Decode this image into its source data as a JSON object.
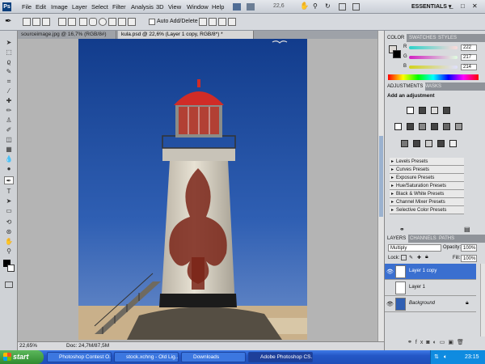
{
  "menubar": {
    "logo": "Ps",
    "items": [
      "File",
      "Edit",
      "Image",
      "Layer",
      "Select",
      "Filter",
      "Analysis",
      "3D",
      "View",
      "Window",
      "Help"
    ],
    "zoom": "22,6",
    "workspace": "ESSENTIALS ▾"
  },
  "options": {
    "auto_add_delete": "Auto Add/Delete"
  },
  "tabs": [
    {
      "label": "sourceimage.jpg @ 16,7% (RGB/8#)"
    },
    {
      "label": "kula.psd @ 22,6% (Layer 1 copy, RGB/8*) *"
    }
  ],
  "status": {
    "zoom": "22,65%",
    "doc": "Doc: 24,7M/87,5M"
  },
  "color_panel": {
    "tabs": [
      "COLOR",
      "SWATCHES",
      "STYLES"
    ],
    "channels": [
      {
        "label": "R",
        "value": "222",
        "color": "#dedad6"
      },
      {
        "label": "G",
        "value": "217",
        "color": "#d9d9d9"
      },
      {
        "label": "B",
        "value": "214",
        "color": "#d6d6d6"
      }
    ]
  },
  "adjustments_panel": {
    "tabs": [
      "ADJUSTMENTS",
      "MASKS"
    ],
    "title": "Add an adjustment",
    "presets": [
      "Levels Presets",
      "Curves Presets",
      "Exposure Presets",
      "Hue/Saturation Presets",
      "Black & White Presets",
      "Channel Mixer Presets",
      "Selective Color Presets"
    ]
  },
  "layers_panel": {
    "tabs": [
      "LAYERS",
      "CHANNELS",
      "PATHS"
    ],
    "blend_mode": "Multiply",
    "opacity_label": "Opacity:",
    "opacity": "100%",
    "lock_label": "Lock:",
    "fill_label": "Fill:",
    "fill": "100%",
    "layers": [
      {
        "name": "Layer 1 copy",
        "selected": true
      },
      {
        "name": "Layer 1",
        "selected": false
      },
      {
        "name": "Background",
        "selected": false
      }
    ]
  },
  "taskbar": {
    "start": "start",
    "tasks": [
      "Photoshop Contest O...",
      "stock.xchng - Old Lig...",
      "Downloads",
      "Adobe Photoshop CS..."
    ],
    "clock": "23:15"
  }
}
